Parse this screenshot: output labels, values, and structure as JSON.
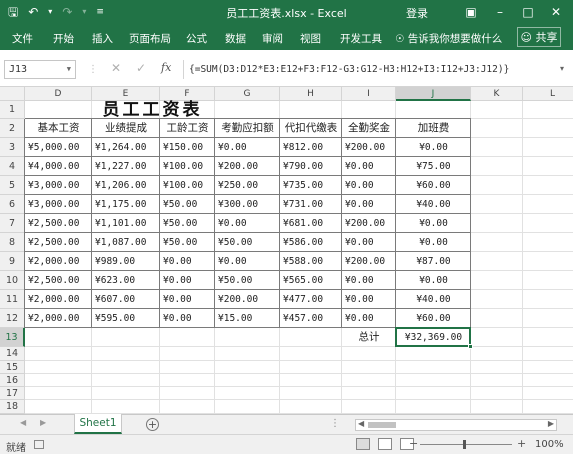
{
  "titlebar": {
    "title": "员工工资表.xlsx - Excel",
    "login": "登录",
    "save_icon": "save-icon",
    "undo_icon": "undo-icon",
    "redo_icon": "redo-icon",
    "customize_icon": "customize-qat-icon",
    "ribbon_display_icon": "ribbon-display-options-icon",
    "minimize_icon": "minimize-icon",
    "maximize_icon": "maximize-icon",
    "close_icon": "close-icon"
  },
  "ribbon": {
    "tabs": [
      "文件",
      "开始",
      "插入",
      "页面布局",
      "公式",
      "数据",
      "审阅",
      "视图",
      "开发工具"
    ],
    "tell_me": "告诉我你想要做什么",
    "share": "共享"
  },
  "formula_bar": {
    "name_box": "J13",
    "formula": "{=SUM(D3:D12*E3:E12+F3:F12-G3:G12-H3:H12+I3:I12+J3:J12)}"
  },
  "grid": {
    "columns": [
      "D",
      "E",
      "F",
      "G",
      "H",
      "I",
      "J",
      "K",
      "L"
    ],
    "rows": [
      "1",
      "2",
      "3",
      "4",
      "5",
      "6",
      "7",
      "8",
      "9",
      "10",
      "11",
      "12",
      "13",
      "14",
      "15",
      "16",
      "17",
      "18"
    ],
    "selected_column": "J",
    "selected_row": "13"
  },
  "sheet": {
    "title": "员工工资表",
    "headers": [
      "基本工资",
      "业绩提成",
      "工龄工资",
      "考勤应扣额",
      "代扣代缴表",
      "全勤奖金",
      "加班费"
    ],
    "rows": [
      [
        "¥5,000.00",
        "¥1,264.00",
        "¥150.00",
        "¥0.00",
        "¥812.00",
        "¥200.00",
        "¥0.00"
      ],
      [
        "¥4,000.00",
        "¥1,227.00",
        "¥100.00",
        "¥200.00",
        "¥790.00",
        "¥0.00",
        "¥75.00"
      ],
      [
        "¥3,000.00",
        "¥1,206.00",
        "¥100.00",
        "¥250.00",
        "¥735.00",
        "¥0.00",
        "¥60.00"
      ],
      [
        "¥3,000.00",
        "¥1,175.00",
        "¥50.00",
        "¥300.00",
        "¥731.00",
        "¥0.00",
        "¥40.00"
      ],
      [
        "¥2,500.00",
        "¥1,101.00",
        "¥50.00",
        "¥0.00",
        "¥681.00",
        "¥200.00",
        "¥0.00"
      ],
      [
        "¥2,500.00",
        "¥1,087.00",
        "¥50.00",
        "¥50.00",
        "¥586.00",
        "¥0.00",
        "¥0.00"
      ],
      [
        "¥2,000.00",
        "¥989.00",
        "¥0.00",
        "¥0.00",
        "¥588.00",
        "¥200.00",
        "¥87.00"
      ],
      [
        "¥2,500.00",
        "¥623.00",
        "¥0.00",
        "¥50.00",
        "¥565.00",
        "¥0.00",
        "¥0.00"
      ],
      [
        "¥2,000.00",
        "¥607.00",
        "¥0.00",
        "¥200.00",
        "¥477.00",
        "¥0.00",
        "¥40.00"
      ],
      [
        "¥2,000.00",
        "¥595.00",
        "¥0.00",
        "¥15.00",
        "¥457.00",
        "¥0.00",
        "¥60.00"
      ]
    ],
    "total_label": "总计",
    "total_value": "¥32,369.00"
  },
  "tabs": {
    "sheet1": "Sheet1",
    "add_icon": "add-sheet-icon"
  },
  "status": {
    "ready": "就绪",
    "zoom": "100%"
  },
  "colors": {
    "excel_green": "#217346",
    "grid_line": "#e1e1e1",
    "table_border": "#7a7a7a"
  }
}
